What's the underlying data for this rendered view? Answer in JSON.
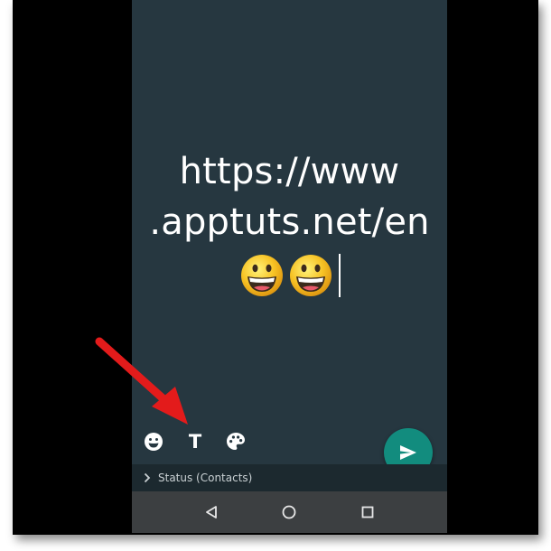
{
  "status_composer": {
    "text_line_1": "https://www",
    "text_line_2": ".apptuts.net/en",
    "emojis": [
      "grinning-face-emoji",
      "grinning-face-emoji"
    ],
    "background_color": "#263740"
  },
  "toolbar": {
    "emoji_icon": "smiley-icon",
    "text_tool_label": "T",
    "palette_icon": "palette-icon"
  },
  "send_button": {
    "icon": "send-icon",
    "color": "#128c7e"
  },
  "status_audience": {
    "label": "Status (Contacts)"
  },
  "navigation": {
    "back_icon": "back-triangle-icon",
    "home_icon": "home-circle-icon",
    "recents_icon": "recents-square-icon"
  },
  "annotation": {
    "arrow_color": "#e31b1b"
  }
}
